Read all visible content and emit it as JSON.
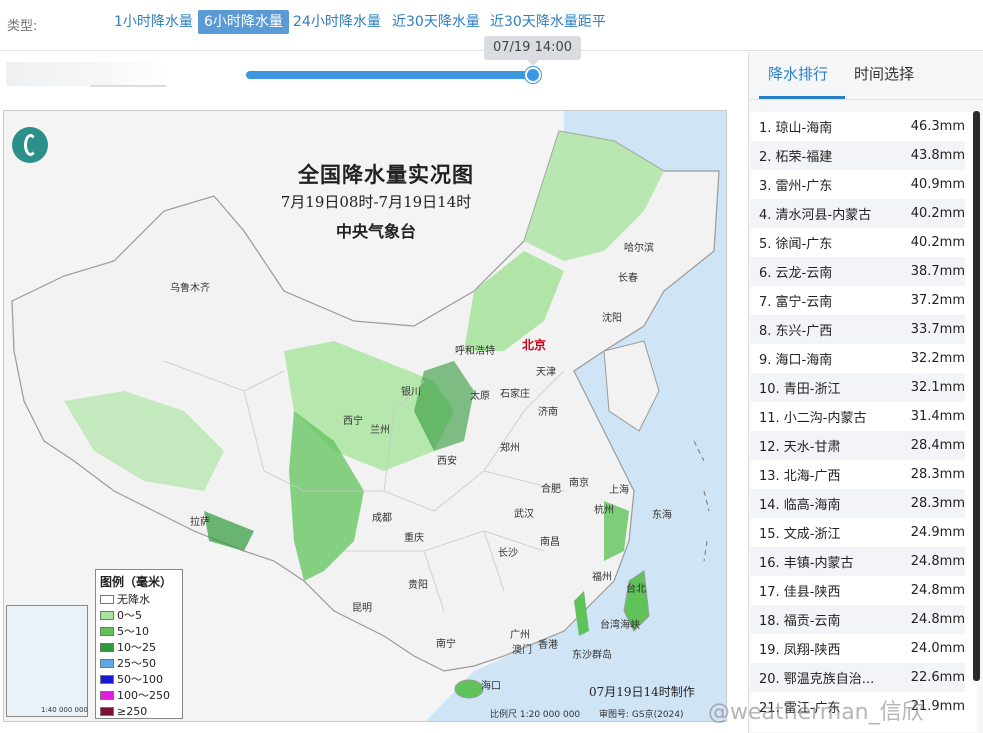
{
  "type_bar": {
    "label": "类型:",
    "tabs": [
      {
        "label": "1小时降水量",
        "active": false
      },
      {
        "label": "6小时降水量",
        "active": true
      },
      {
        "label": "24小时降水量",
        "active": false
      },
      {
        "label": "近30天降水量",
        "active": false
      },
      {
        "label": "近30天降水量距平",
        "active": false
      }
    ]
  },
  "slider": {
    "time_label": "07/19 14:00",
    "progress": 1.0
  },
  "map": {
    "title": "全国降水量实况图",
    "period": "7月19日08时-7月19日14时",
    "agency": "中央气象台",
    "made_at": "07月19日14时制作",
    "scale": "比例尺 1:20 000 000",
    "review_no": "审图号: GS京(2024)",
    "inset_scale": "1:40 000 000",
    "cities": {
      "harbin": "哈尔滨",
      "changchun": "长春",
      "shenyang": "沈阳",
      "urumqi": "乌鲁木齐",
      "hohhot": "呼和浩特",
      "beijing": "北京",
      "tianjin": "天津",
      "yinchuan": "银川",
      "taiyuan": "太原",
      "shijiazhuang": "石家庄",
      "jinan": "济南",
      "xining": "西宁",
      "lanzhou": "兰州",
      "zhengzhou": "郑州",
      "xian": "西安",
      "hefei": "合肥",
      "nanjing": "南京",
      "shanghai": "上海",
      "wuhan": "武汉",
      "hangzhou": "杭州",
      "chengdu": "成都",
      "chongqing": "重庆",
      "lhasa": "拉萨",
      "changsha": "长沙",
      "nanchang": "南昌",
      "fuzhou": "福州",
      "taipei": "台北",
      "guiyang": "贵阳",
      "kunming": "昆明",
      "nanning": "南宁",
      "guangzhou": "广州",
      "hongkong": "香港",
      "macau": "澳门",
      "haikou": "海口",
      "dongsha": "东沙群岛",
      "taiwan_strait": "台湾海峡",
      "east_sea": "东海"
    },
    "legend": {
      "title": "图例（毫米）",
      "items": [
        {
          "label": "无降水",
          "color": "#ffffff"
        },
        {
          "label": "0～5",
          "color": "#a6e39b"
        },
        {
          "label": "5～10",
          "color": "#5fc35a"
        },
        {
          "label": "10～25",
          "color": "#2f9a3a"
        },
        {
          "label": "25～50",
          "color": "#5ea8e8"
        },
        {
          "label": "50～100",
          "color": "#1717d6"
        },
        {
          "label": "100～250",
          "color": "#e31ae3"
        },
        {
          "label": "≥250",
          "color": "#7b1030"
        }
      ]
    }
  },
  "right_panel": {
    "tabs": [
      {
        "label": "降水排行",
        "active": true
      },
      {
        "label": "时间选择",
        "active": false
      }
    ],
    "ranking": [
      {
        "name": "1. 琼山-海南",
        "value": "46.3mm"
      },
      {
        "name": "2. 柘荣-福建",
        "value": "43.8mm"
      },
      {
        "name": "3. 雷州-广东",
        "value": "40.9mm"
      },
      {
        "name": "4. 清水河县-内蒙古",
        "value": "40.2mm"
      },
      {
        "name": "5. 徐闻-广东",
        "value": "40.2mm"
      },
      {
        "name": "6. 云龙-云南",
        "value": "38.7mm"
      },
      {
        "name": "7. 富宁-云南",
        "value": "37.2mm"
      },
      {
        "name": "8. 东兴-广西",
        "value": "33.7mm"
      },
      {
        "name": "9. 海口-海南",
        "value": "32.2mm"
      },
      {
        "name": "10. 青田-浙江",
        "value": "32.1mm"
      },
      {
        "name": "11. 小二沟-内蒙古",
        "value": "31.4mm"
      },
      {
        "name": "12. 天水-甘肃",
        "value": "28.4mm"
      },
      {
        "name": "13. 北海-广西",
        "value": "28.3mm"
      },
      {
        "name": "14. 临高-海南",
        "value": "28.3mm"
      },
      {
        "name": "15. 文成-浙江",
        "value": "24.9mm"
      },
      {
        "name": "16. 丰镇-内蒙古",
        "value": "24.8mm"
      },
      {
        "name": "17. 佳县-陕西",
        "value": "24.8mm"
      },
      {
        "name": "18. 福贡-云南",
        "value": "24.8mm"
      },
      {
        "name": "19. 凤翔-陕西",
        "value": "24.0mm"
      },
      {
        "name": "20. 鄂温克族自治...",
        "value": "22.6mm"
      },
      {
        "name": "21. 雷江-广东",
        "value": "21.9mm"
      }
    ]
  },
  "watermark": "@weatherman_信欣"
}
